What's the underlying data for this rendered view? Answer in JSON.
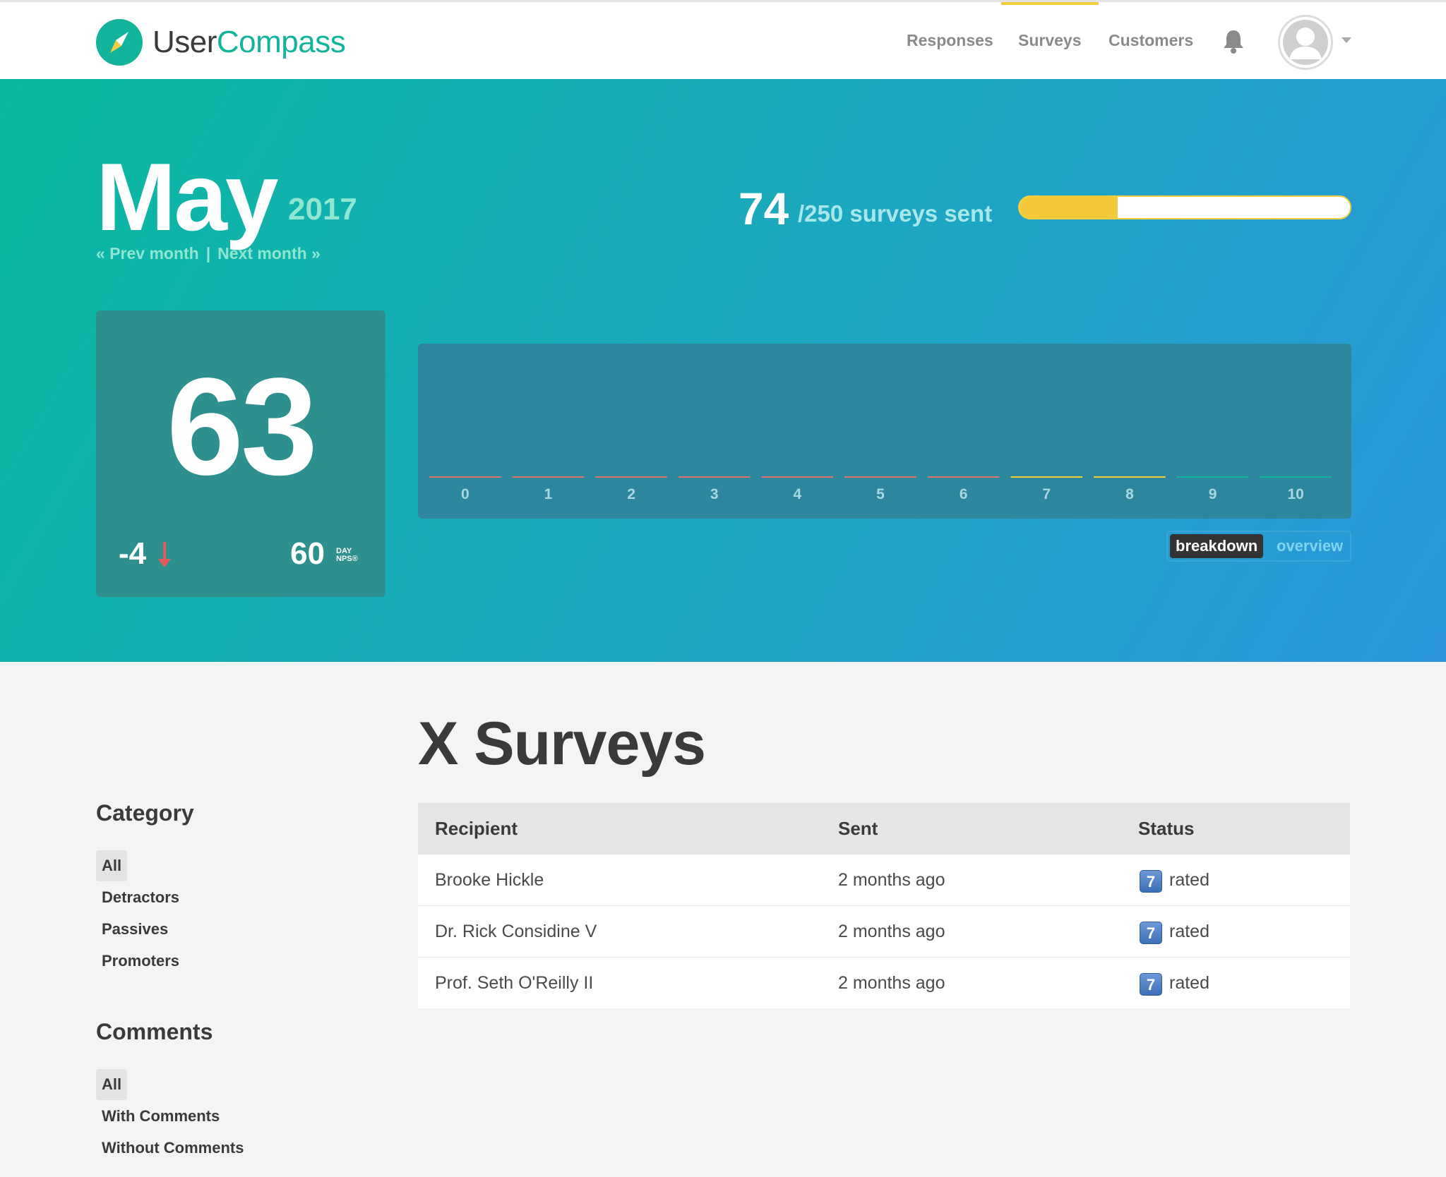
{
  "brand": {
    "name_part1": "User",
    "name_part2": "Compass"
  },
  "nav": {
    "links": [
      "Responses",
      "Surveys",
      "Customers"
    ],
    "active": "Surveys",
    "icons": [
      "bell-icon",
      "avatar-icon",
      "caret-down-icon"
    ]
  },
  "hero": {
    "month": "May",
    "year": "2017",
    "prev_month": "« Prev month",
    "separator": "|",
    "next_month": "Next month »",
    "sent_count": "74",
    "sent_label": "/250 surveys sent",
    "sent_progress_fraction": 0.296,
    "nps_score": "63",
    "nps_change": "-4",
    "nps_60_value": "60",
    "nps_60_label_line1": "DAY",
    "nps_60_label_line2": "NPS®",
    "toggle_on": "breakdown",
    "toggle_off": "overview"
  },
  "colors": {
    "brand_teal": "#12b49b",
    "accent_yellow": "#f3cd3c",
    "detractor": "#e0736f",
    "passive": "#f3cd3c",
    "promoter": "#0fb49a",
    "change_down": "#e75a5a"
  },
  "chart_data": {
    "type": "bar",
    "categories": [
      "0",
      "1",
      "2",
      "3",
      "4",
      "5",
      "6",
      "7",
      "8",
      "9",
      "10"
    ],
    "values": [
      0,
      0,
      0,
      0,
      0,
      0,
      0,
      0,
      0,
      0,
      0
    ],
    "groups": [
      "detractor",
      "detractor",
      "detractor",
      "detractor",
      "detractor",
      "detractor",
      "detractor",
      "passive",
      "passive",
      "promoter",
      "promoter"
    ]
  },
  "main": {
    "title": "X Surveys",
    "category": {
      "heading": "Category",
      "items": [
        "All",
        "Detractors",
        "Passives",
        "Promoters"
      ],
      "active": "All"
    },
    "comments": {
      "heading": "Comments",
      "items": [
        "All",
        "With Comments",
        "Without Comments"
      ],
      "active": "All"
    },
    "table": {
      "headers": [
        "Recipient",
        "Sent",
        "Status"
      ],
      "rows": [
        {
          "recipient": "Brooke Hickle",
          "sent": "2 months ago",
          "score": "7",
          "status": "rated"
        },
        {
          "recipient": "Dr. Rick Considine V",
          "sent": "2 months ago",
          "score": "7",
          "status": "rated"
        },
        {
          "recipient": "Prof. Seth O'Reilly II",
          "sent": "2 months ago",
          "score": "7",
          "status": "rated"
        }
      ]
    }
  }
}
